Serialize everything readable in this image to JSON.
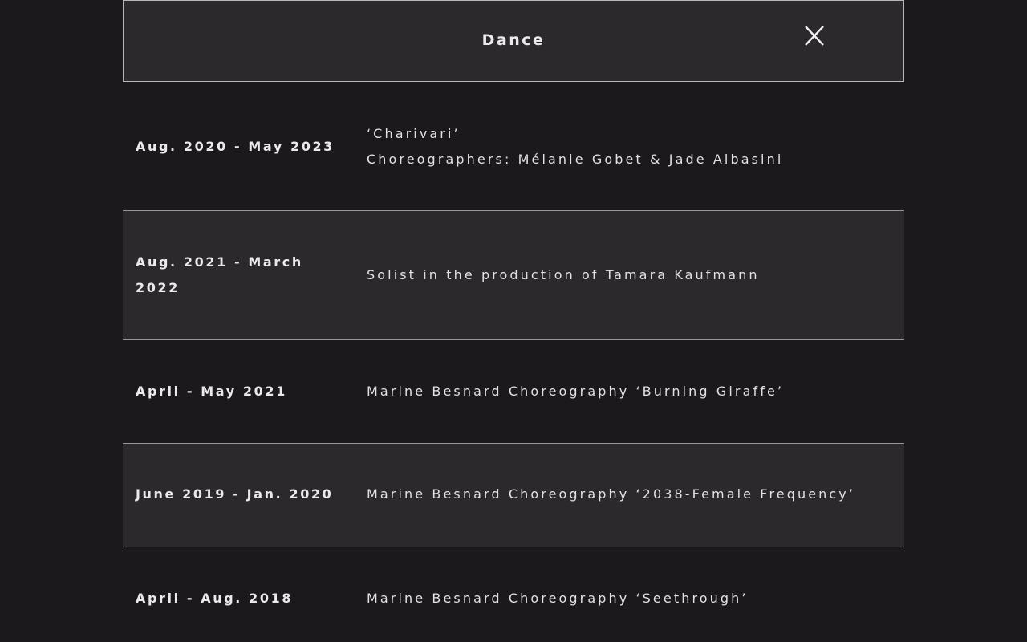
{
  "header": {
    "title": "Dance",
    "close_icon": "close-icon"
  },
  "entries": [
    {
      "date": "Aug. 2020 - May 2023",
      "lines": [
        "‘Charivari’",
        "Choreographers: Mélanie Gobet & Jade Albasini"
      ]
    },
    {
      "date_lines": [
        "Aug. 2021 - March",
        "2022"
      ],
      "lines": [
        "Solist in the production of Tamara Kaufmann"
      ]
    },
    {
      "date": "April - May 2021",
      "lines": [
        "Marine Besnard Choreography ‘Burning Giraffe’"
      ]
    },
    {
      "date": "June 2019 - Jan. 2020",
      "lines": [
        "Marine Besnard Choreography ‘2038-Female Frequency’"
      ]
    },
    {
      "date": "April - Aug. 2018",
      "lines": [
        "Marine Besnard Choreography ‘Seethrough’"
      ]
    }
  ],
  "colors": {
    "background": "#1b191c",
    "panel_shaded": "#2b292c",
    "border": "#b9b6ba",
    "text": "#ece8ec"
  }
}
